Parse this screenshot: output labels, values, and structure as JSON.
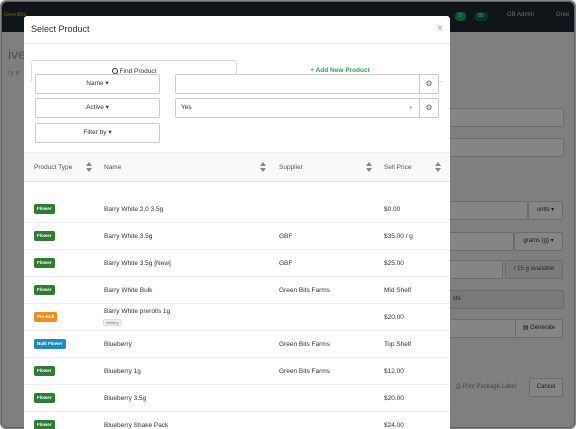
{
  "background": {
    "brand": "GreenBits",
    "badges": [
      "2",
      "80"
    ],
    "user": "GB Admin",
    "user2": "Gree",
    "title": "ive",
    "subtitle": "ry tr",
    "units_label": "units ▾",
    "grams_label": "grams (g) ▾",
    "available_text": "/ 15 g available",
    "cts_text": "cts",
    "generate_label": "Generate",
    "print_label": "Print Package Label",
    "cancel_label": "Cancel"
  },
  "modal": {
    "title": "Select Product",
    "close": "×",
    "tabs": [
      {
        "label": "Find Product",
        "icon": "search-icon",
        "active": true
      },
      {
        "label": "+ Add New Product",
        "active": false,
        "color": "#2e9e4f"
      }
    ],
    "filters": [
      {
        "label": "Name ▾",
        "value": "",
        "has_dropdown": false
      },
      {
        "label": "Active ▾",
        "value": "Yes",
        "has_dropdown": true
      },
      {
        "label": "Filter by ▾"
      }
    ],
    "gear_icon": "gear-icon",
    "columns": [
      "Product Type",
      "Name",
      "Supplier",
      "Sell Price"
    ],
    "rows": [
      {
        "type": "Flower",
        "type_color": "#2e7d32",
        "name": "Barry White 2.0 3.5g",
        "supplier": "",
        "price": "$0.00",
        "tag": ""
      },
      {
        "type": "Flower",
        "type_color": "#2e7d32",
        "name": "Barry White 3.5g",
        "supplier": "GBF",
        "price": "$35.00 / g",
        "tag": ""
      },
      {
        "type": "Flower",
        "type_color": "#2e7d32",
        "name": "Barry White 3.5g [New]",
        "supplier": "GBF",
        "price": "$25.00",
        "tag": ""
      },
      {
        "type": "Flower",
        "type_color": "#2e7d32",
        "name": "Barry White Bulk",
        "supplier": "Green Bits Farms",
        "price": "Mid Shelf",
        "tag": ""
      },
      {
        "type": "Pre-Roll",
        "type_color": "#f08c1e",
        "name": "Barry White prerolls 1g",
        "supplier": "",
        "price": "$20.00",
        "tag": "military"
      },
      {
        "type": "Bulk Flower",
        "type_color": "#1e88c8",
        "name": "Blueberry",
        "supplier": "Green Bits Farms",
        "price": "Top Shelf",
        "tag": ""
      },
      {
        "type": "Flower",
        "type_color": "#2e7d32",
        "name": "Blueberry 1g",
        "supplier": "Green Bits Farms",
        "price": "$12.00",
        "tag": ""
      },
      {
        "type": "Flower",
        "type_color": "#2e7d32",
        "name": "Blueberry 3.5g",
        "supplier": "",
        "price": "$20.00",
        "tag": ""
      },
      {
        "type": "Flower",
        "type_color": "#2e7d32",
        "name": "Blueberry Shake Pack",
        "supplier": "",
        "price": "$24.00",
        "tag": ""
      }
    ]
  }
}
